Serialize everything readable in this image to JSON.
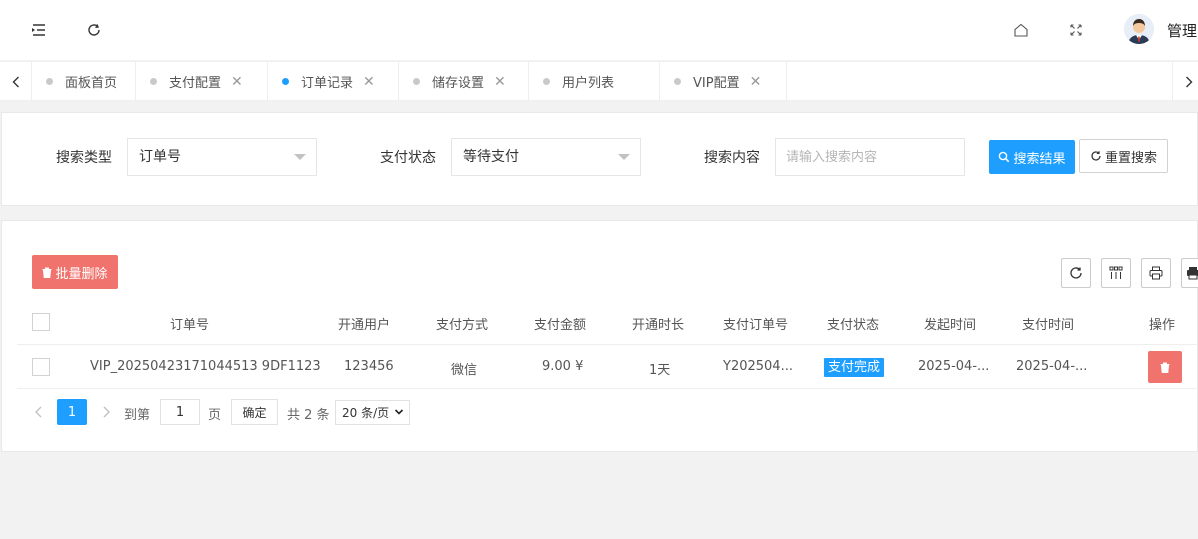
{
  "header": {
    "menu_icon": "menu-fold-icon",
    "refresh_icon": "refresh-icon",
    "home_icon": "home-icon",
    "fullscreen_icon": "fullscreen-icon",
    "user_name": "管理"
  },
  "tabs": [
    {
      "label": "面板首页",
      "closable": false,
      "active": false
    },
    {
      "label": "支付配置",
      "closable": true,
      "active": false
    },
    {
      "label": "订单记录",
      "closable": true,
      "active": true
    },
    {
      "label": "储存设置",
      "closable": true,
      "active": false
    },
    {
      "label": "用户列表",
      "closable": true,
      "active": false
    },
    {
      "label": "VIP配置",
      "closable": true,
      "active": false
    }
  ],
  "search": {
    "type_label": "搜索类型",
    "type_value": "订单号",
    "status_label": "支付状态",
    "status_value": "等待支付",
    "content_label": "搜索内容",
    "content_placeholder": "请输入搜索内容",
    "search_button": "搜索结果",
    "reset_button": "重置搜索"
  },
  "toolbar": {
    "batch_delete": "批量删除"
  },
  "table": {
    "columns": [
      "订单号",
      "开通用户",
      "支付方式",
      "支付金额",
      "开通时长",
      "支付订单号",
      "支付状态",
      "发起时间",
      "支付时间",
      "操作"
    ],
    "rows": [
      {
        "order_no": "VIP_20250423171044513 9DF1123",
        "user": "123456",
        "method": "微信",
        "amount": "9.00 ¥",
        "duration": "1天",
        "pay_order_no": "Y202504...",
        "status": "支付完成",
        "created": "2025-04-...",
        "paid": "2025-04-..."
      }
    ]
  },
  "pagination": {
    "current": "1",
    "goto_label": "到第",
    "goto_value": "1",
    "page_unit": "页",
    "confirm": "确定",
    "total": "共 2 条",
    "page_size": "20 条/页"
  },
  "colors": {
    "primary": "#1e9fff",
    "danger": "#f0736e",
    "background": "#f2f2f2"
  }
}
